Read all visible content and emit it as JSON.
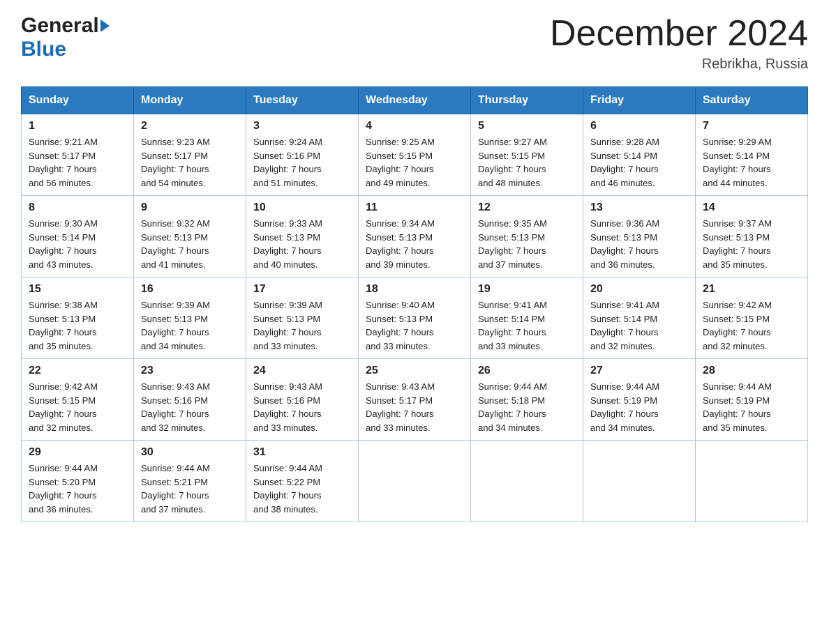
{
  "header": {
    "logo_general": "General",
    "logo_blue": "Blue",
    "month_year": "December 2024",
    "location": "Rebrikha, Russia"
  },
  "days_of_week": [
    "Sunday",
    "Monday",
    "Tuesday",
    "Wednesday",
    "Thursday",
    "Friday",
    "Saturday"
  ],
  "weeks": [
    [
      {
        "day": "1",
        "sunrise": "9:21 AM",
        "sunset": "5:17 PM",
        "daylight": "7 hours and 56 minutes."
      },
      {
        "day": "2",
        "sunrise": "9:23 AM",
        "sunset": "5:17 PM",
        "daylight": "7 hours and 54 minutes."
      },
      {
        "day": "3",
        "sunrise": "9:24 AM",
        "sunset": "5:16 PM",
        "daylight": "7 hours and 51 minutes."
      },
      {
        "day": "4",
        "sunrise": "9:25 AM",
        "sunset": "5:15 PM",
        "daylight": "7 hours and 49 minutes."
      },
      {
        "day": "5",
        "sunrise": "9:27 AM",
        "sunset": "5:15 PM",
        "daylight": "7 hours and 48 minutes."
      },
      {
        "day": "6",
        "sunrise": "9:28 AM",
        "sunset": "5:14 PM",
        "daylight": "7 hours and 46 minutes."
      },
      {
        "day": "7",
        "sunrise": "9:29 AM",
        "sunset": "5:14 PM",
        "daylight": "7 hours and 44 minutes."
      }
    ],
    [
      {
        "day": "8",
        "sunrise": "9:30 AM",
        "sunset": "5:14 PM",
        "daylight": "7 hours and 43 minutes."
      },
      {
        "day": "9",
        "sunrise": "9:32 AM",
        "sunset": "5:13 PM",
        "daylight": "7 hours and 41 minutes."
      },
      {
        "day": "10",
        "sunrise": "9:33 AM",
        "sunset": "5:13 PM",
        "daylight": "7 hours and 40 minutes."
      },
      {
        "day": "11",
        "sunrise": "9:34 AM",
        "sunset": "5:13 PM",
        "daylight": "7 hours and 39 minutes."
      },
      {
        "day": "12",
        "sunrise": "9:35 AM",
        "sunset": "5:13 PM",
        "daylight": "7 hours and 37 minutes."
      },
      {
        "day": "13",
        "sunrise": "9:36 AM",
        "sunset": "5:13 PM",
        "daylight": "7 hours and 36 minutes."
      },
      {
        "day": "14",
        "sunrise": "9:37 AM",
        "sunset": "5:13 PM",
        "daylight": "7 hours and 35 minutes."
      }
    ],
    [
      {
        "day": "15",
        "sunrise": "9:38 AM",
        "sunset": "5:13 PM",
        "daylight": "7 hours and 35 minutes."
      },
      {
        "day": "16",
        "sunrise": "9:39 AM",
        "sunset": "5:13 PM",
        "daylight": "7 hours and 34 minutes."
      },
      {
        "day": "17",
        "sunrise": "9:39 AM",
        "sunset": "5:13 PM",
        "daylight": "7 hours and 33 minutes."
      },
      {
        "day": "18",
        "sunrise": "9:40 AM",
        "sunset": "5:13 PM",
        "daylight": "7 hours and 33 minutes."
      },
      {
        "day": "19",
        "sunrise": "9:41 AM",
        "sunset": "5:14 PM",
        "daylight": "7 hours and 33 minutes."
      },
      {
        "day": "20",
        "sunrise": "9:41 AM",
        "sunset": "5:14 PM",
        "daylight": "7 hours and 32 minutes."
      },
      {
        "day": "21",
        "sunrise": "9:42 AM",
        "sunset": "5:15 PM",
        "daylight": "7 hours and 32 minutes."
      }
    ],
    [
      {
        "day": "22",
        "sunrise": "9:42 AM",
        "sunset": "5:15 PM",
        "daylight": "7 hours and 32 minutes."
      },
      {
        "day": "23",
        "sunrise": "9:43 AM",
        "sunset": "5:16 PM",
        "daylight": "7 hours and 32 minutes."
      },
      {
        "day": "24",
        "sunrise": "9:43 AM",
        "sunset": "5:16 PM",
        "daylight": "7 hours and 33 minutes."
      },
      {
        "day": "25",
        "sunrise": "9:43 AM",
        "sunset": "5:17 PM",
        "daylight": "7 hours and 33 minutes."
      },
      {
        "day": "26",
        "sunrise": "9:44 AM",
        "sunset": "5:18 PM",
        "daylight": "7 hours and 34 minutes."
      },
      {
        "day": "27",
        "sunrise": "9:44 AM",
        "sunset": "5:19 PM",
        "daylight": "7 hours and 34 minutes."
      },
      {
        "day": "28",
        "sunrise": "9:44 AM",
        "sunset": "5:19 PM",
        "daylight": "7 hours and 35 minutes."
      }
    ],
    [
      {
        "day": "29",
        "sunrise": "9:44 AM",
        "sunset": "5:20 PM",
        "daylight": "7 hours and 36 minutes."
      },
      {
        "day": "30",
        "sunrise": "9:44 AM",
        "sunset": "5:21 PM",
        "daylight": "7 hours and 37 minutes."
      },
      {
        "day": "31",
        "sunrise": "9:44 AM",
        "sunset": "5:22 PM",
        "daylight": "7 hours and 38 minutes."
      },
      null,
      null,
      null,
      null
    ]
  ],
  "labels": {
    "sunrise": "Sunrise:",
    "sunset": "Sunset:",
    "daylight": "Daylight:"
  }
}
